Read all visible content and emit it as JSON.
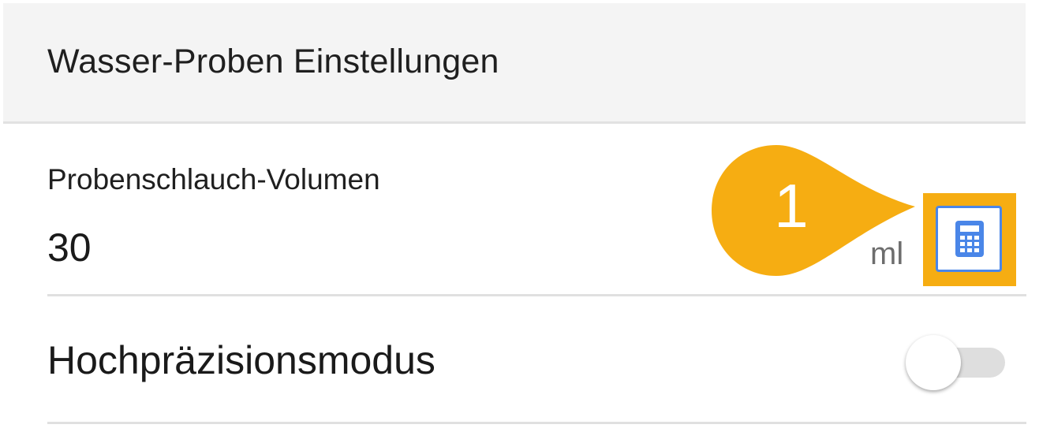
{
  "header": {
    "title": "Wasser-Proben Einstellungen"
  },
  "volume_setting": {
    "label": "Probenschlauch-Volumen",
    "value": "30",
    "unit": "ml",
    "calculator_icon": "calculator-icon"
  },
  "callout": {
    "number": "1",
    "color": "#f6ad12"
  },
  "precision_setting": {
    "label": "Hochpräzisionsmodus",
    "enabled": false
  },
  "colors": {
    "accent_blue": "#4a86e8",
    "callout_orange": "#f6ad12",
    "header_bg": "#f4f4f4"
  }
}
